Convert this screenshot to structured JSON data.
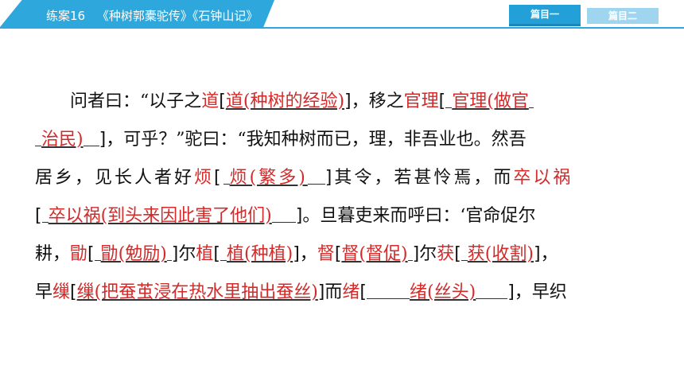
{
  "header": {
    "lesson": "练案16",
    "title": "《种树郭橐驼传》《石钟山记》"
  },
  "nav": {
    "active": "篇目一",
    "inactive": "篇目二"
  },
  "text": {
    "l1_a": "问者曰：“以子之",
    "l1_k1": "道",
    "l1_a1": "道(种树的经验)",
    "l1_b": "，移之",
    "l1_k2": "官理",
    "l1_a2": "官理(做官",
    "l2_a2": "治民)",
    "l2_b": "，可乎？”驼曰：“我知种树而已，理，非吾业也。然吾",
    "l3_a": "居乡，见长人者好",
    "l3_k1": "烦",
    "l3_a1": "烦(繁多)",
    "l3_b": "其令，若甚怜焉，而",
    "l3_k2": "卒以祸",
    "l4_a1": "卒以祸(到头来因此害了他们)",
    "l4_b": "。旦暮吏来而呼曰：‘官命促尔",
    "l5_a": "耕，",
    "l5_k1": "勖",
    "l5_a1": "勖(勉励)",
    "l5_b": "尔",
    "l5_k2": "植",
    "l5_a2": "植(种植)",
    "l5_c": "，",
    "l5_k3": "督",
    "l5_a3": "督(督促)",
    "l5_d": "尔",
    "l5_k4": "获",
    "l5_a4": "获(收割)",
    "l5_e": "，",
    "l6_a": "早",
    "l6_k1": "缫",
    "l6_a1": "缫(把蚕茧浸在热水里抽出蚕丝)",
    "l6_b": "而",
    "l6_k2": "绪",
    "l6_a2": "绪(丝头)",
    "l6_c": "，早织"
  },
  "colors": {
    "header_blue": "#2ea8dc",
    "answer_red": "#d32a2a"
  }
}
